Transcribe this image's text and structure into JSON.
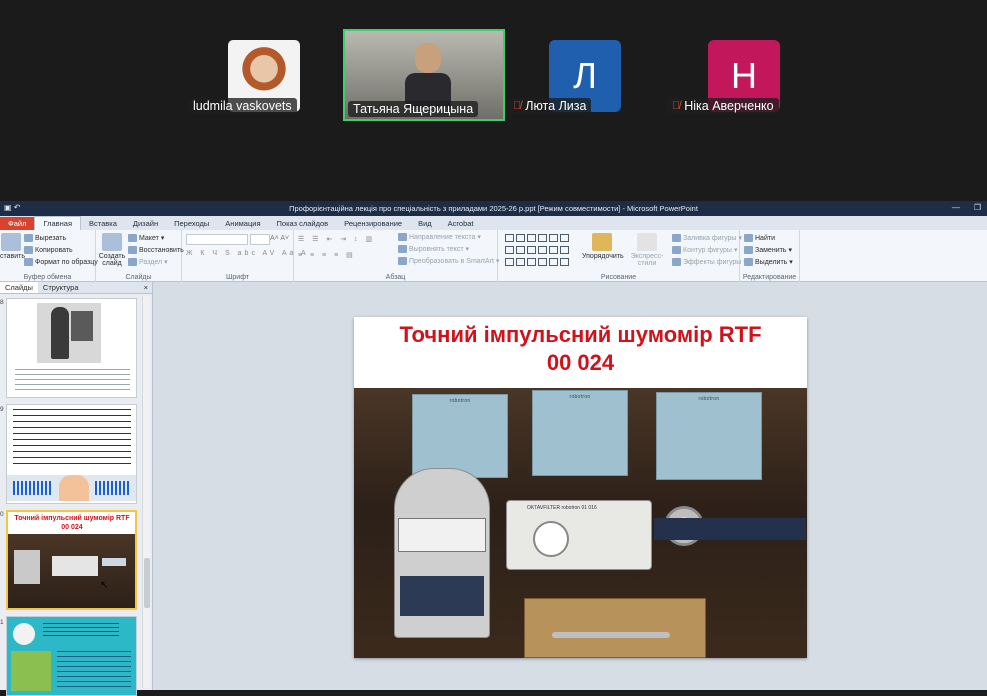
{
  "gallery": {
    "participants": [
      {
        "name": "ludmila vaskovets",
        "type": "photo",
        "muted": false
      },
      {
        "name": "Татьяна Ящерицына",
        "type": "video",
        "muted": false,
        "active_speaker": true
      },
      {
        "name": "Люта Лиза",
        "type": "initial",
        "initial": "Л",
        "color": "#1f5fae",
        "muted": true
      },
      {
        "name": "Ніка Аверченко",
        "type": "initial",
        "initial": "Н",
        "color": "#c2185b",
        "muted": true
      }
    ]
  },
  "powerpoint": {
    "title": "Профорієнтаційна лекція про  спеціальність з приладами 2025-26 р.ppt [Режим совместимости] - Microsoft PowerPoint",
    "tabs": [
      "Файл",
      "Главная",
      "Вставка",
      "Дизайн",
      "Переходы",
      "Анимация",
      "Показ слайдов",
      "Рецензирование",
      "Вид",
      "Acrobat"
    ],
    "active_tab": "Главная",
    "ribbon": {
      "clipboard": {
        "paste": "ставить",
        "cut": "Вырезать",
        "copy": "Копировать",
        "format": "Формат по образцу",
        "name": "Буфер обмена"
      },
      "slides": {
        "new_slide": "Создать слайд",
        "layout": "Макет",
        "reset": "Восстановить",
        "section": "Раздел",
        "name": "Слайды"
      },
      "font": {
        "name": "Шрифт"
      },
      "paragraph": {
        "text_dir": "Направление текста",
        "align_text": "Выровнять текст",
        "smartart": "Преобразовать в SmartArt",
        "name": "Абзац"
      },
      "drawing": {
        "arrange": "Упорядочить",
        "quick_styles": "Экспресс-стили",
        "fill": "Заливка фигуры",
        "outline": "Контур фигуры",
        "effects": "Эффекты фигуры",
        "name": "Рисование"
      },
      "editing": {
        "find": "Найти",
        "replace": "Заменить",
        "select": "Выделить",
        "name": "Редактирование"
      }
    },
    "pane": {
      "tabs": [
        "Слайды",
        "Структура"
      ],
      "close": "×",
      "thumbs": [
        {
          "num": "8"
        },
        {
          "num": "9"
        },
        {
          "num": "0",
          "title": "Точний імпульсний шумомір RTF 00 024"
        },
        {
          "num": "1"
        }
      ]
    },
    "slide": {
      "title_line1": "Точний імпульсний шумомір RTF",
      "title_line2": "00 024",
      "poster1": "robotron",
      "poster2": "robotron",
      "poster3": "robotron",
      "device_label": "OKTAVFILTER robotron 01 016"
    }
  }
}
